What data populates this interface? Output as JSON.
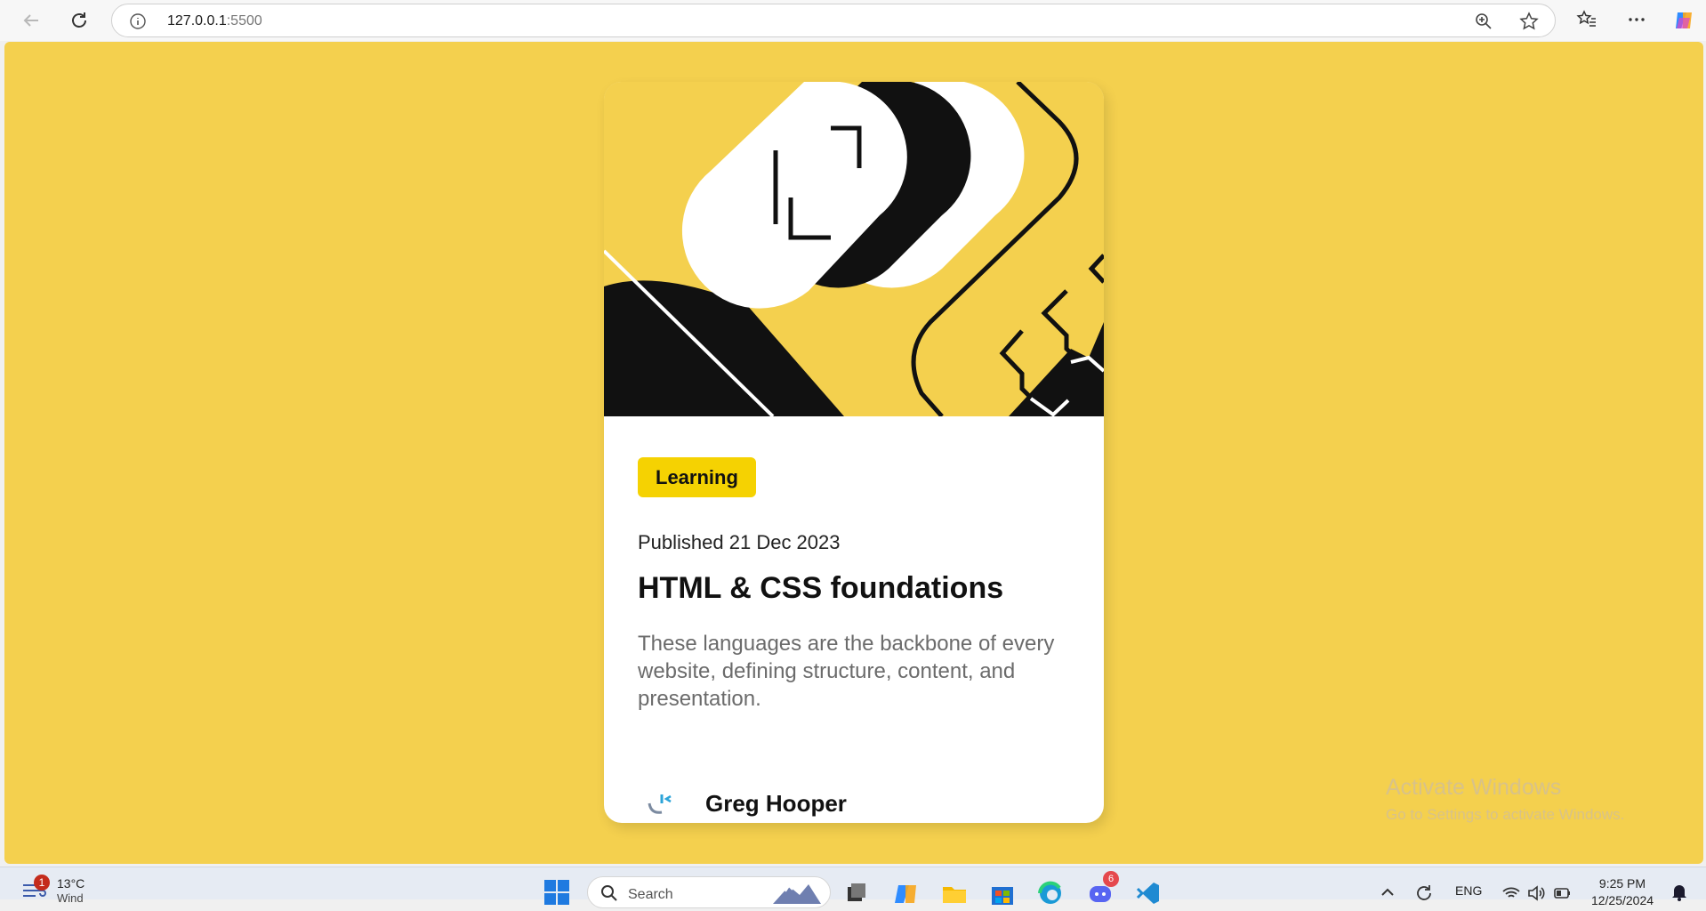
{
  "browser": {
    "url_host": "127.0.0.1",
    "url_port": ":5500"
  },
  "card": {
    "tag": "Learning",
    "published": "Published 21 Dec 2023",
    "title": "HTML & CSS foundations",
    "description": "These languages are the backbone of every website, defining structure, content, and presentation.",
    "author": "Greg Hooper"
  },
  "watermark": {
    "line1": "Activate Windows",
    "line2": "Go to Settings to activate Windows."
  },
  "taskbar": {
    "weather_badge": "1",
    "temperature": "13°C",
    "weather_sub": "Wind",
    "search_placeholder": "Search",
    "mail_badge": "6",
    "language": "ENG",
    "time": "9:25 PM",
    "date": "12/25/2024"
  },
  "colors": {
    "page_bg": "#f4d04e",
    "tag_bg": "#f5d202",
    "ink": "#111111"
  }
}
